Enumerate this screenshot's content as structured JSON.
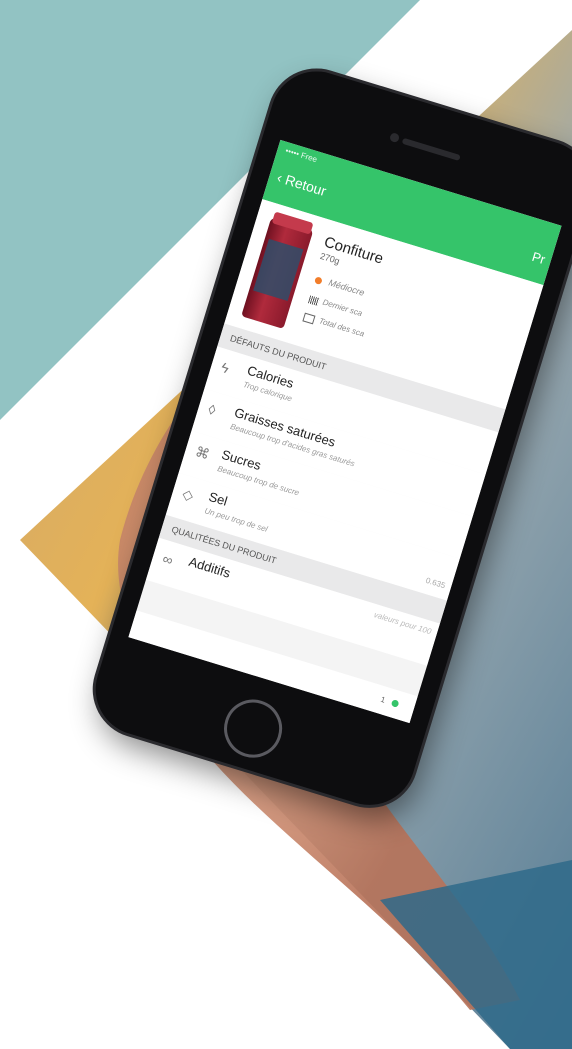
{
  "colors": {
    "teal": "#92c3c3",
    "accent_green": "#35c46a",
    "rating_orange": "#f27d2a"
  },
  "phone": {
    "status_bar": "••••• Free",
    "nav": {
      "back_label": "Retour",
      "title": "Pr"
    },
    "product": {
      "name": "Confiture",
      "weight": "270g",
      "rating": "Médiocre",
      "last_scan": "Dernier sca",
      "total_scans": "Total des sca"
    },
    "defects": {
      "header": "DÉFAUTS DU PRODUIT",
      "items": [
        {
          "title": "Calories",
          "subtitle": "Trop calorique",
          "icon": "lightning-icon"
        },
        {
          "title": "Graisses saturées",
          "subtitle": "Beaucoup trop d'acides gras saturés",
          "icon": "drop-icon"
        },
        {
          "title": "Sucres",
          "subtitle": "Beaucoup trop de sucre",
          "icon": "candy-icon"
        },
        {
          "title": "Sel",
          "subtitle": "Un peu trop de sel",
          "value": "0.635",
          "icon": "salt-icon"
        }
      ]
    },
    "qualities": {
      "header": "QUALITÉES DU PRODUIT",
      "values_note": "valeurs pour 100",
      "items": [
        {
          "title": "Additifs",
          "icon": "molecule-icon"
        }
      ]
    },
    "page_indicator": "1"
  }
}
